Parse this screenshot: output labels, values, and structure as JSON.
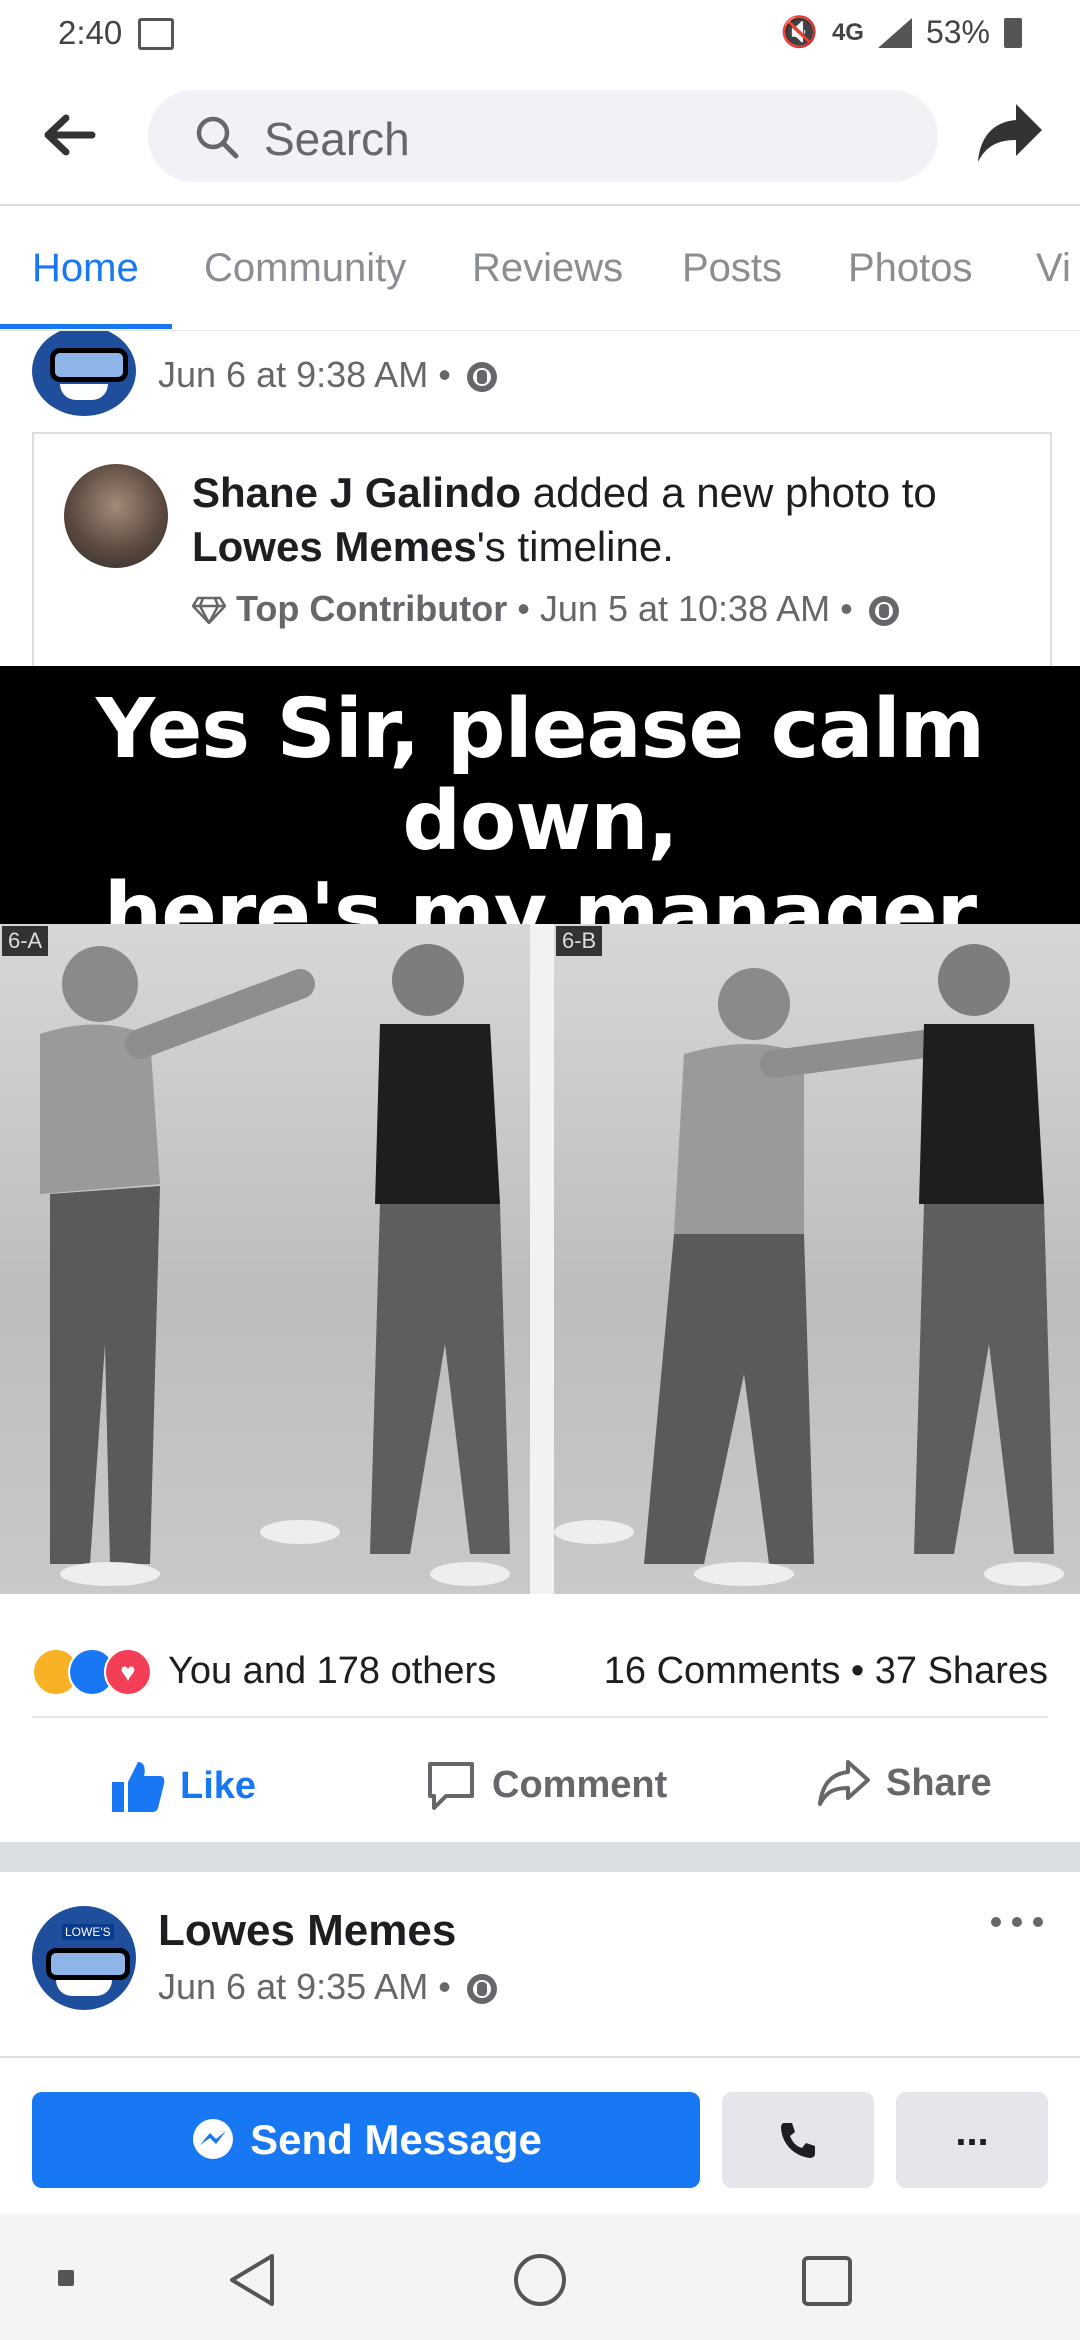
{
  "status_bar": {
    "time": "2:40",
    "network": "4G",
    "battery": "53%"
  },
  "search": {
    "placeholder": "Search"
  },
  "tabs": [
    {
      "label": "Home",
      "active": true
    },
    {
      "label": "Community"
    },
    {
      "label": "Reviews"
    },
    {
      "label": "Posts"
    },
    {
      "label": "Photos"
    },
    {
      "label": "Vi"
    }
  ],
  "prev_post": {
    "timestamp": "Jun 6 at 9:38 AM",
    "separator": "•"
  },
  "shared_post": {
    "author": "Shane J Galindo",
    "action": "added a new photo to",
    "page": "Lowes Memes",
    "suffix": "'s timeline.",
    "badge": "Top Contributor",
    "timestamp": "Jun 5 at 10:38 AM",
    "separator": "•"
  },
  "meme": {
    "caption_line1": "Yes Sir, please calm down,",
    "caption_line2": "here's my manager now...",
    "panel_a": "6-A",
    "panel_b": "6-B"
  },
  "engagement": {
    "reactions_text": "You and 178 others",
    "comments": "16 Comments",
    "shares": "37 Shares",
    "separator": "•"
  },
  "actions": {
    "like": "Like",
    "comment": "Comment",
    "share": "Share"
  },
  "next_post": {
    "page": "Lowes Memes",
    "timestamp": "Jun 6 at 9:35 AM",
    "separator": "•",
    "avatar_text": "LOWE'S"
  },
  "message_bar": {
    "send_label": "Send Message",
    "more_label": "..."
  },
  "colors": {
    "accent": "#1877f2",
    "text_secondary": "#65676b",
    "love": "#f33e58",
    "haha": "#f7b125"
  }
}
